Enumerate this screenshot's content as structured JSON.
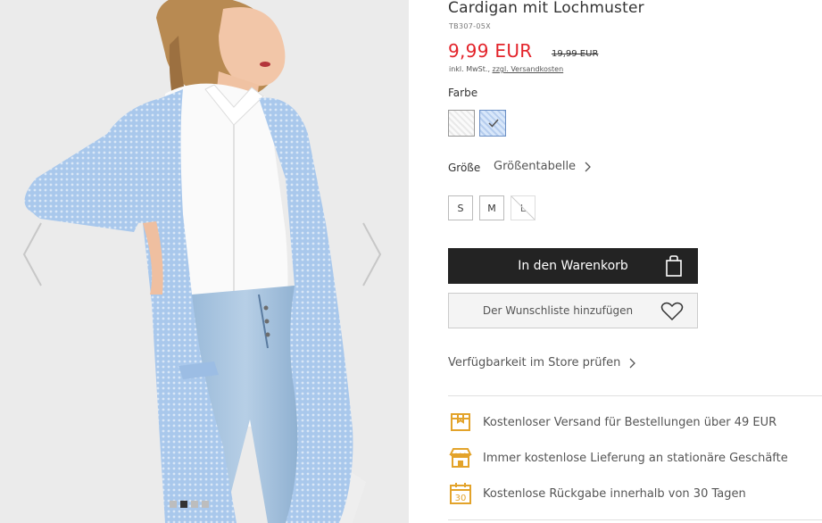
{
  "product": {
    "title": "Cardigan mit Lochmuster",
    "sku": "TB307-05X",
    "price": "9,99 EUR",
    "old_price": "19,99 EUR",
    "vat_note": "inkl. MwSt.,",
    "shipping_link": "zzgl. Versandkosten"
  },
  "color": {
    "label": "Farbe",
    "swatches": [
      {
        "name": "white"
      },
      {
        "name": "light blue",
        "selected": true
      }
    ]
  },
  "size": {
    "label": "Größe",
    "guide_label": "Größentabelle",
    "options": [
      {
        "label": "S",
        "available": true
      },
      {
        "label": "M",
        "available": true
      },
      {
        "label": "L",
        "available": false
      }
    ]
  },
  "actions": {
    "add_to_cart": "In den Warenkorb",
    "add_to_wishlist": "Der Wunschliste hinzufügen",
    "store_availability": "Verfügbarkeit im Store prüfen"
  },
  "benefits": [
    {
      "icon": "shipping-box-icon",
      "text": "Kostenloser Versand für Bestellungen über 49 EUR"
    },
    {
      "icon": "store-icon",
      "text": "Immer kostenlose Lieferung an stationäre Geschäfte"
    },
    {
      "icon": "calendar-30-icon",
      "text": "Kostenlose Rückgabe innerhalb von 30 Tagen",
      "icon_text": "30"
    }
  ],
  "gallery": {
    "dots": 4,
    "active_dot": 1
  },
  "colors": {
    "price_red": "#e3232a",
    "button_dark": "#232323",
    "benefit_icon": "#e3a32a",
    "cardigan_blue": "#a9c8ec"
  }
}
